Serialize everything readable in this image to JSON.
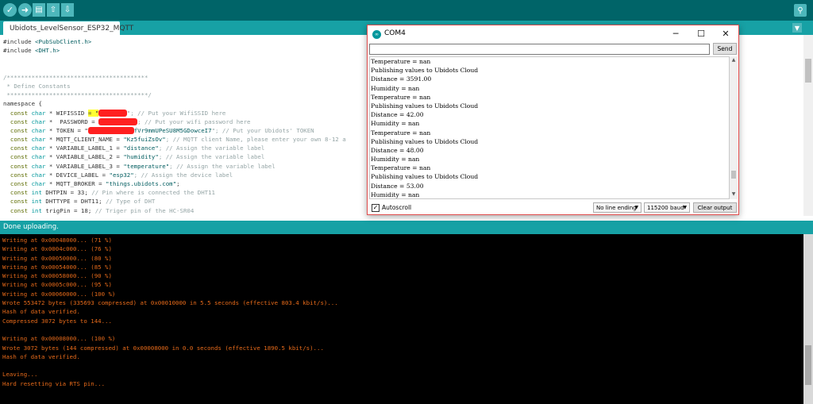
{
  "toolbar": {
    "verify_icon": "checkmark-icon",
    "upload_icon": "arrow-right-icon",
    "new_icon": "new-file-icon",
    "open_icon": "arrow-up-icon",
    "save_icon": "arrow-down-icon",
    "serial_monitor_icon": "magnifier-icon"
  },
  "tab": {
    "label": "Ubidots_LevelSensor_ESP32_MQTT"
  },
  "status": {
    "text": "Done uploading."
  },
  "colors": {
    "toolbar_bg": "#006468",
    "tabbar_bg": "#17a1a5",
    "console_text": "#e66a1a",
    "console_bg": "#000000"
  },
  "code_lines": [
    [
      {
        "t": "#include ",
        "c": ""
      },
      {
        "t": "<PubSubClient.h>",
        "c": "str"
      }
    ],
    [
      {
        "t": "#include ",
        "c": ""
      },
      {
        "t": "<DHT.h>",
        "c": "str"
      }
    ],
    [
      {
        "t": "",
        "c": ""
      }
    ],
    [
      {
        "t": "",
        "c": ""
      }
    ],
    [
      {
        "t": "/****************************************",
        "c": "cmt"
      }
    ],
    [
      {
        "t": " * Define Constants",
        "c": "cmt"
      }
    ],
    [
      {
        "t": " ****************************************/",
        "c": "cmt"
      }
    ],
    [
      {
        "t": "namespace {",
        "c": ""
      }
    ],
    [
      {
        "t": "  const ",
        "c": "kw-green"
      },
      {
        "t": "char",
        "c": "kw-blue"
      },
      {
        "t": " * WIFISSID ",
        "c": ""
      },
      {
        "t": "= \"",
        "c": "hl"
      },
      {
        "t": "xxxxxxxx",
        "c": "redact"
      },
      {
        "t": "\"; // Put your WifiSSID here",
        "c": "cmt"
      }
    ],
    [
      {
        "t": "  const ",
        "c": "kw-green"
      },
      {
        "t": "char",
        "c": "kw-blue"
      },
      {
        "t": " *  PASSWORD = ",
        "c": ""
      },
      {
        "t": "xxxxxxxxxxx",
        "c": "redact"
      },
      {
        "t": "; // Put your wifi password here",
        "c": "cmt"
      }
    ],
    [
      {
        "t": "  const ",
        "c": "kw-green"
      },
      {
        "t": "char",
        "c": "kw-blue"
      },
      {
        "t": " * TOKEN = \"",
        "c": ""
      },
      {
        "t": "xxxxxxxxxxxxx",
        "c": "redact"
      },
      {
        "t": "fVr9mmUPeSU8M5GDowceI7",
        "c": "str"
      },
      {
        "t": "\"; // Put your Ubidots' TOKEN",
        "c": "cmt"
      }
    ],
    [
      {
        "t": "  const ",
        "c": "kw-green"
      },
      {
        "t": "char",
        "c": "kw-blue"
      },
      {
        "t": " * MQTT_CLIENT_NAME = ",
        "c": ""
      },
      {
        "t": "\"Kz5fuiZsOv\"",
        "c": "str"
      },
      {
        "t": "; // MQTT client Name, please enter your own 8-12 a",
        "c": "cmt"
      }
    ],
    [
      {
        "t": "  const ",
        "c": "kw-green"
      },
      {
        "t": "char",
        "c": "kw-blue"
      },
      {
        "t": " * VARIABLE_LABEL_1 = ",
        "c": ""
      },
      {
        "t": "\"distance\"",
        "c": "str"
      },
      {
        "t": "; // Assign the variable label",
        "c": "cmt"
      }
    ],
    [
      {
        "t": "  const ",
        "c": "kw-green"
      },
      {
        "t": "char",
        "c": "kw-blue"
      },
      {
        "t": " * VARIABLE_LABEL_2 = ",
        "c": ""
      },
      {
        "t": "\"humidity\"",
        "c": "str"
      },
      {
        "t": "; // Assign the variable label",
        "c": "cmt"
      }
    ],
    [
      {
        "t": "  const ",
        "c": "kw-green"
      },
      {
        "t": "char",
        "c": "kw-blue"
      },
      {
        "t": " * VARIABLE_LABEL_3 = ",
        "c": ""
      },
      {
        "t": "\"temperature\"",
        "c": "str"
      },
      {
        "t": "; // Assign the variable label",
        "c": "cmt"
      }
    ],
    [
      {
        "t": "  const ",
        "c": "kw-green"
      },
      {
        "t": "char",
        "c": "kw-blue"
      },
      {
        "t": " * DEVICE_LABEL = ",
        "c": ""
      },
      {
        "t": "\"esp32\"",
        "c": "str"
      },
      {
        "t": "; // Assign the device label",
        "c": "cmt"
      }
    ],
    [
      {
        "t": "  const ",
        "c": "kw-green"
      },
      {
        "t": "char",
        "c": "kw-blue"
      },
      {
        "t": " * MQTT_BROKER = ",
        "c": ""
      },
      {
        "t": "\"things.ubidots.com\"",
        "c": "str"
      },
      {
        "t": ";",
        "c": ""
      }
    ],
    [
      {
        "t": "  const ",
        "c": "kw-green"
      },
      {
        "t": "int",
        "c": "kw-blue"
      },
      {
        "t": " DHTPIN = 33; ",
        "c": ""
      },
      {
        "t": "// Pin where is connected the DHT11",
        "c": "cmt"
      }
    ],
    [
      {
        "t": "  const ",
        "c": "kw-green"
      },
      {
        "t": "int",
        "c": "kw-blue"
      },
      {
        "t": " DHTTYPE = DHT11; ",
        "c": ""
      },
      {
        "t": "// Type of DHT",
        "c": "cmt"
      }
    ],
    [
      {
        "t": "  const ",
        "c": "kw-green"
      },
      {
        "t": "int",
        "c": "kw-blue"
      },
      {
        "t": " trigPin = 18; ",
        "c": ""
      },
      {
        "t": "// Triger pin of the HC-SR04",
        "c": "cmt"
      }
    ]
  ],
  "console_lines": [
    "Writing at 0x00048000... (71 %)",
    "Writing at 0x0004c000... (76 %)",
    "Writing at 0x00050000... (80 %)",
    "Writing at 0x00054000... (85 %)",
    "Writing at 0x00058000... (90 %)",
    "Writing at 0x0005c000... (95 %)",
    "Writing at 0x00060000... (100 %)",
    "Wrote 553472 bytes (335693 compressed) at 0x00010000 in 5.5 seconds (effective 803.4 kbit/s)...",
    "Hash of data verified.",
    "Compressed 3072 bytes to 144...",
    "",
    "Writing at 0x00008000... (100 %)",
    "Wrote 3072 bytes (144 compressed) at 0x00008000 in 0.0 seconds (effective 1890.5 kbit/s)...",
    "Hash of data verified.",
    "",
    "Leaving...",
    "Hard resetting via RTS pin..."
  ],
  "serial_monitor": {
    "title": "COM4",
    "input_value": "",
    "send_label": "Send",
    "autoscroll_label": "Autoscroll",
    "autoscroll_checked": "✓",
    "line_ending": "No line ending",
    "baud": "115200 baud",
    "clear_label": "Clear output",
    "output": [
      "Temperature = nan",
      "Publishing values to Ubidots Cloud",
      "Distance = 3591.00",
      "Humidity = nan",
      "Temperature = nan",
      "Publishing values to Ubidots Cloud",
      "Distance = 42.00",
      "Humidity = nan",
      "Temperature = nan",
      "Publishing values to Ubidots Cloud",
      "Distance = 48.00",
      "Humidity = nan",
      "Temperature = nan",
      "Publishing values to Ubidots Cloud",
      "Distance = 53.00",
      "Humidity = nan"
    ]
  }
}
